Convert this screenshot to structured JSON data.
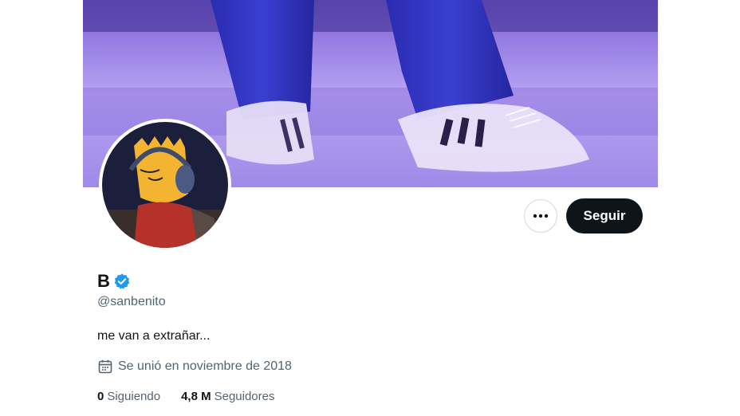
{
  "profile": {
    "display_name": "B",
    "handle": "@sanbenito",
    "bio": "me van a extrañar...",
    "joined": "Se unió en noviembre de 2018",
    "verified": true,
    "verified_badge_color": "#1d9bf0"
  },
  "actions": {
    "more_icon": "more-horizontal-icon",
    "follow_label": "Seguir"
  },
  "stats": {
    "following_count": "0",
    "following_label": "Siguiendo",
    "followers_count": "4,8 M",
    "followers_label": "Seguidores"
  },
  "colors": {
    "follow_button_bg": "#0f1419",
    "secondary_text": "#536471",
    "banner_tint": "#a58df0"
  }
}
